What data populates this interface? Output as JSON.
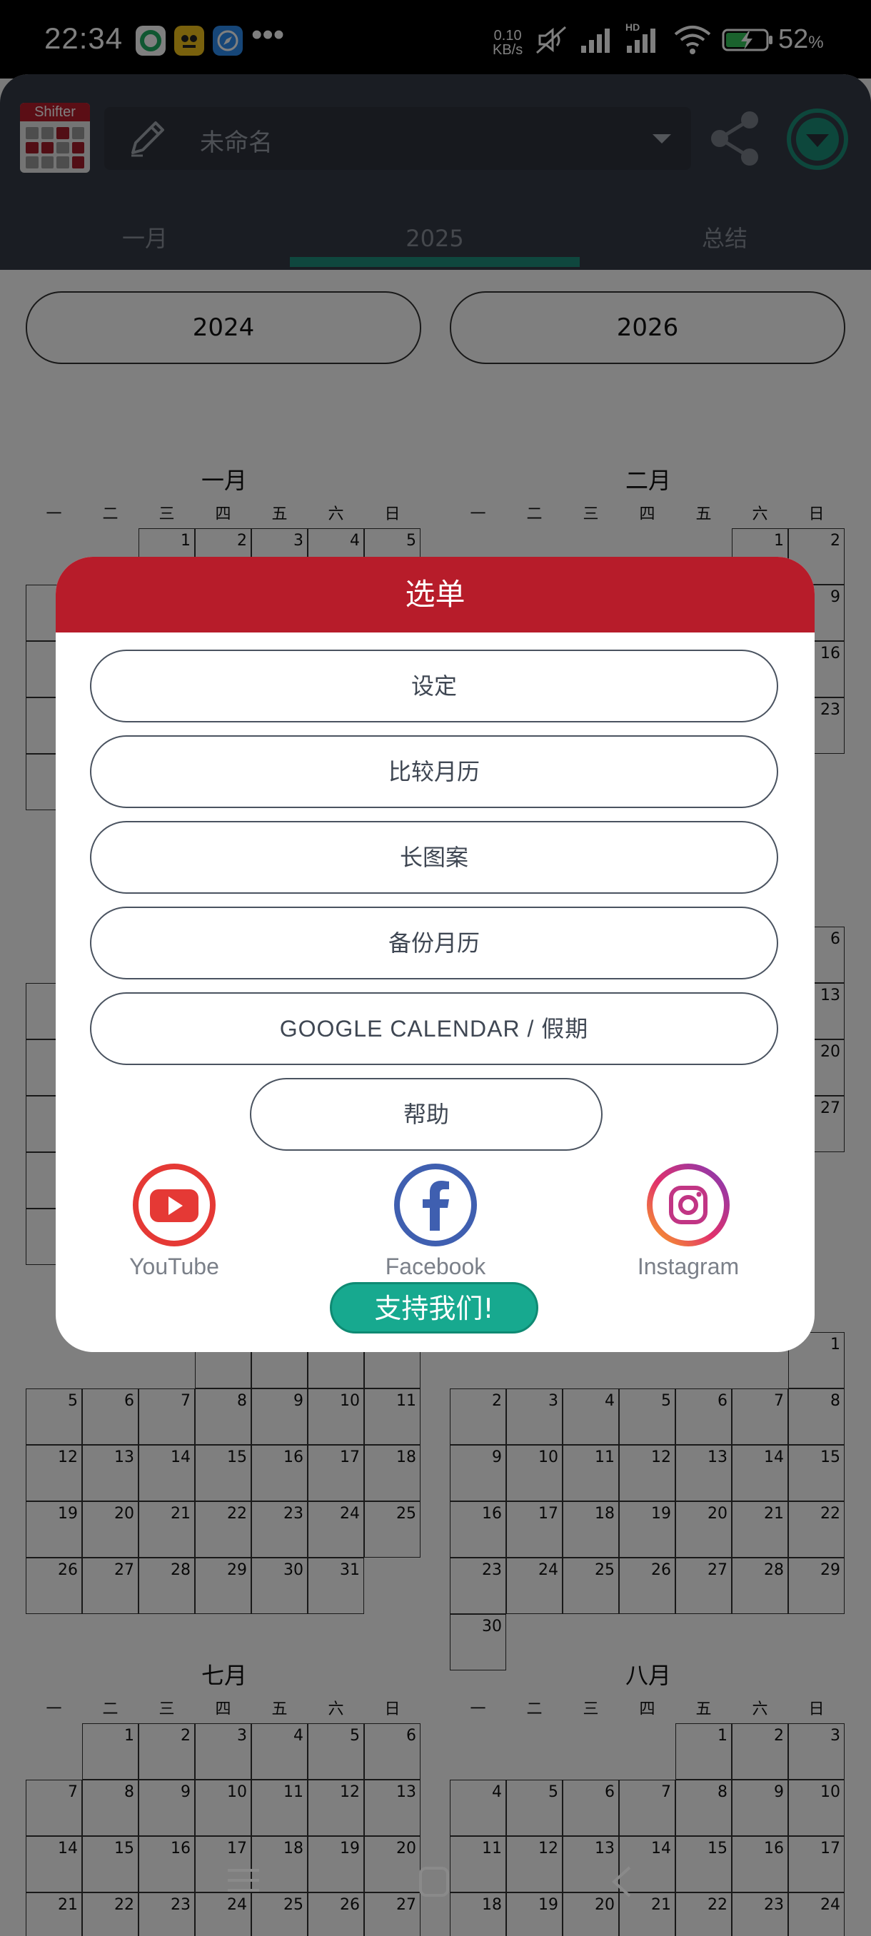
{
  "status_bar": {
    "time": "22:34",
    "net_speed_value": "0.10",
    "net_speed_unit": "KB/s",
    "signal_label": "HD",
    "battery_percent": "52",
    "battery_unit": "%",
    "overflow": "•••",
    "icons": [
      "notification-app-icon",
      "notification-app-icon",
      "browser-icon",
      "mute-icon",
      "signal-icon",
      "signal-hd-icon",
      "wifi-icon",
      "battery-charging-icon"
    ]
  },
  "header": {
    "logo_text": "Shifter",
    "calendar_name": "未命名",
    "tabs": [
      {
        "label": "一月"
      },
      {
        "label": "2025",
        "active": true
      },
      {
        "label": "总结"
      }
    ],
    "accent_color": "#1e8f7c"
  },
  "year_nav": {
    "prev_label": "2024",
    "next_label": "2026"
  },
  "calendar": {
    "weekday_labels": [
      "一",
      "二",
      "三",
      "四",
      "五",
      "六",
      "日"
    ],
    "months": [
      {
        "title": "一月",
        "offset": 2,
        "days": 31
      },
      {
        "title": "二月",
        "offset": 5,
        "days": 28
      },
      {
        "title": "",
        "offset": 5,
        "days": 31
      },
      {
        "title": "",
        "offset": 1,
        "days": 30
      },
      {
        "title": "",
        "offset": 3,
        "days": 31
      },
      {
        "title": "",
        "offset": 6,
        "days": 30
      },
      {
        "title": "七月",
        "offset": 1,
        "days": 31
      },
      {
        "title": "八月",
        "offset": 4,
        "days": 31
      }
    ]
  },
  "menu": {
    "title": "选单",
    "buttons": [
      "设定",
      "比较月历",
      "长图案",
      "备份月历",
      "GOOGLE CALENDAR / 假期"
    ],
    "help_label": "帮助",
    "social": [
      {
        "label": "YouTube",
        "color": "#e53935"
      },
      {
        "label": "Facebook",
        "color": "#3f5fb0"
      },
      {
        "label": "Instagram",
        "color": "#c13584"
      }
    ],
    "support_label": "支持我们!",
    "header_color": "#b71c2a",
    "support_color": "#17a98f"
  },
  "nav_bar": {
    "icons": [
      "menu-icon",
      "home-icon",
      "back-icon"
    ]
  }
}
